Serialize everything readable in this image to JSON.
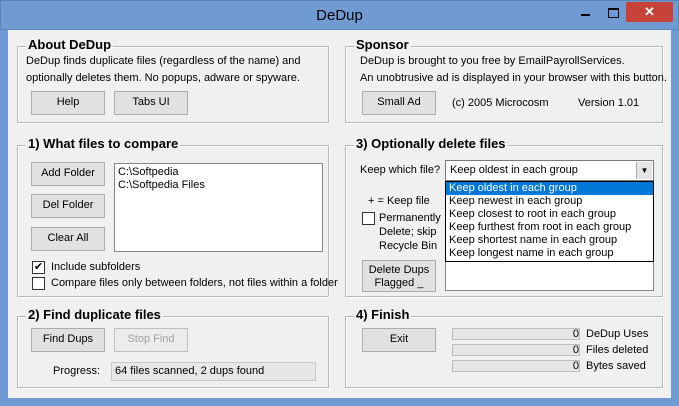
{
  "window": {
    "title": "DeDup",
    "close_glyph": "✕"
  },
  "about": {
    "title": "About DeDup",
    "line1": "DeDup finds duplicate files (regardless of the name) and",
    "line2": "optionally deletes them.   No popups, adware or spyware.",
    "help_label": "Help",
    "tabs_label": "Tabs UI"
  },
  "sponsor": {
    "title": "Sponsor",
    "line1": "DeDup is brought to you free by EmailPayrollServices.",
    "line2": "An unobtrusive ad is displayed in your browser with this button.",
    "small_ad_label": "Small Ad",
    "copyright": "(c) 2005 Microcosm",
    "version": "Version 1.01"
  },
  "compare": {
    "title": "1) What files to compare",
    "add_folder_label": "Add Folder",
    "del_folder_label": "Del Folder",
    "clear_all_label": "Clear All",
    "folders": [
      "C:\\Softpedia",
      "C:\\Softpedia Files"
    ],
    "include_subfolders_label": "Include subfolders",
    "include_subfolders_checked": true,
    "compare_between_label": "Compare files only between folders, not files within a folder",
    "compare_between_checked": false,
    "check_glyph": "✔"
  },
  "delete": {
    "title": "3) Optionally delete files",
    "keep_which_label": "Keep which file?",
    "selected_option": "Keep oldest in each group",
    "options": [
      "Keep oldest in each group",
      "Keep newest in each group",
      "Keep closest to root in each group",
      "Keep furthest from root in each group",
      "Keep shortest name in each group",
      "Keep longest name in each group"
    ],
    "keep_file_legend": "+ = Keep file",
    "permanently_label": "Permanently",
    "delete_skip_label": "Delete; skip",
    "recycle_bin_label": "Recycle Bin",
    "permanently_checked": false,
    "delete_dups_label_1": "Delete Dups",
    "delete_dups_label_2": "Flagged _"
  },
  "find": {
    "title": "2) Find duplicate files",
    "find_dups_label": "Find Dups",
    "stop_find_label": "Stop Find",
    "progress_label": "Progress:",
    "progress_text": "64 files scanned, 2 dups found"
  },
  "finish": {
    "title": "4) Finish",
    "exit_label": "Exit",
    "stats": [
      {
        "value": "0",
        "label": "DeDup Uses"
      },
      {
        "value": "0",
        "label": "Files deleted"
      },
      {
        "value": "0",
        "label": "Bytes saved"
      }
    ]
  }
}
